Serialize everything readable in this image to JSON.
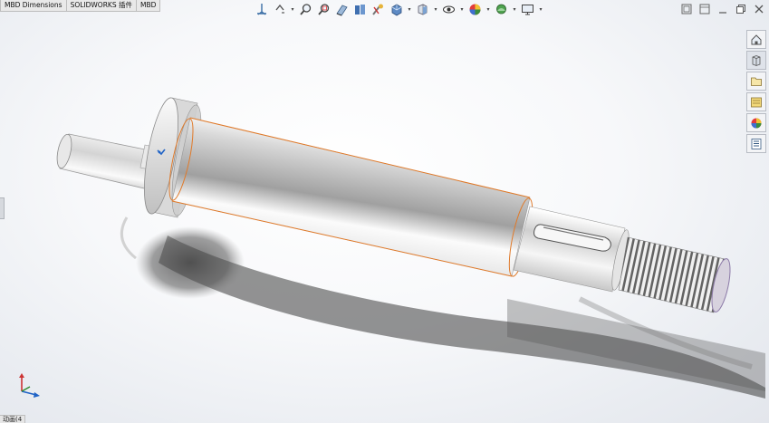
{
  "tabs": [
    {
      "label": "MBD Dimensions"
    },
    {
      "label": "SOLIDWORKS 插件"
    },
    {
      "label": "MBD"
    }
  ],
  "toolbar_icons": [
    "view-orientation-icon",
    "previous-view-icon",
    "zoom-to-fit-icon",
    "zoom-to-area-icon",
    "section-view-icon",
    "dynamic-annotation-icon",
    "view-settings-icon",
    "display-style-icon",
    "hide-show-items-icon",
    "edit-appearance-icon",
    "apply-scene-icon",
    "view-settings-monitor-icon"
  ],
  "window_controls": [
    "restore-icon",
    "tile-icon",
    "minimize-icon",
    "maximize-icon",
    "close-icon"
  ],
  "task_pane": [
    {
      "name": "solidworks-resources-icon"
    },
    {
      "name": "design-library-icon"
    },
    {
      "name": "file-explorer-icon"
    },
    {
      "name": "view-palette-icon"
    },
    {
      "name": "appearances-icon"
    },
    {
      "name": "custom-properties-icon"
    }
  ],
  "status_bar": {
    "label": "动画(4"
  },
  "colors": {
    "accent_blue": "#1f63c6",
    "selection_orange": "#e07a2a",
    "part_gray": "#c8c8c8"
  }
}
